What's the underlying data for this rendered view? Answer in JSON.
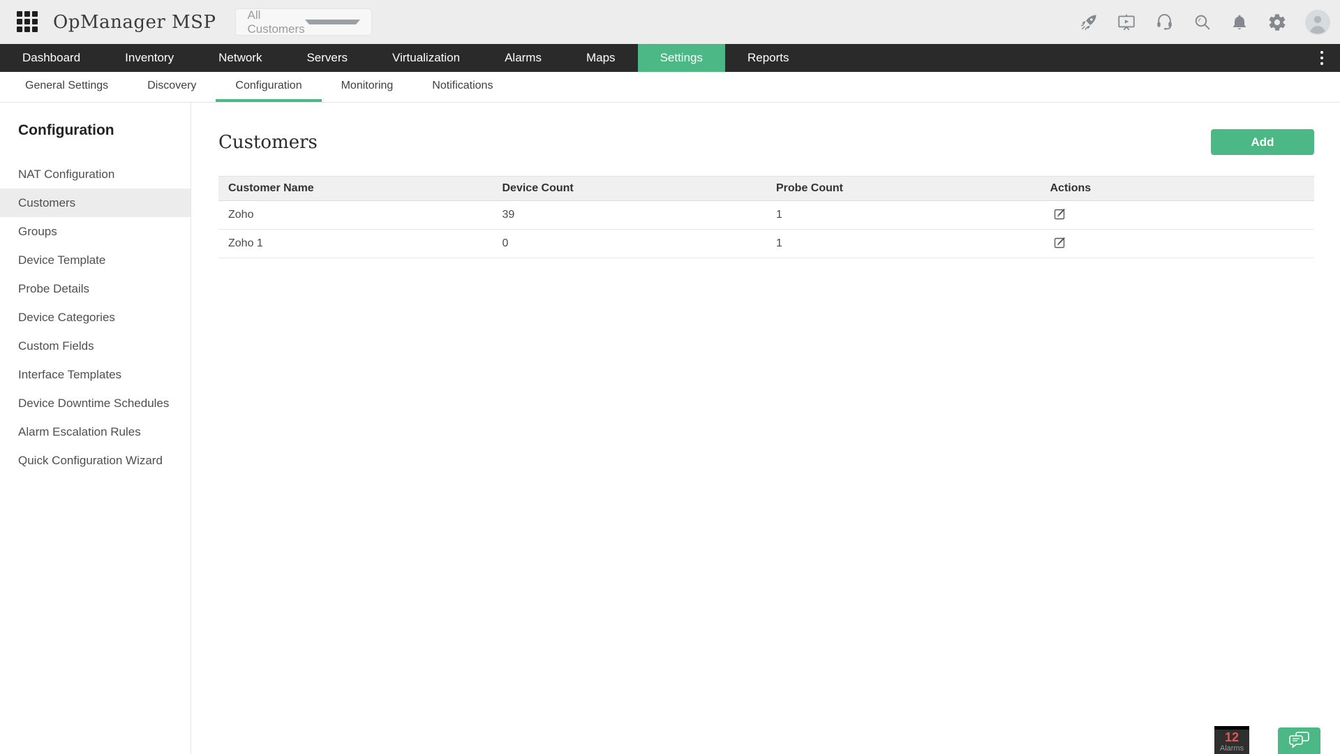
{
  "topbar": {
    "app_title": "OpManager MSP",
    "customer_dropdown": {
      "value": "All Customers"
    }
  },
  "nav": {
    "items": [
      {
        "label": "Dashboard",
        "active": false
      },
      {
        "label": "Inventory",
        "active": false
      },
      {
        "label": "Network",
        "active": false
      },
      {
        "label": "Servers",
        "active": false
      },
      {
        "label": "Virtualization",
        "active": false
      },
      {
        "label": "Alarms",
        "active": false
      },
      {
        "label": "Maps",
        "active": false
      },
      {
        "label": "Settings",
        "active": true
      },
      {
        "label": "Reports",
        "active": false
      }
    ]
  },
  "subnav": {
    "items": [
      {
        "label": "General Settings",
        "active": false
      },
      {
        "label": "Discovery",
        "active": false
      },
      {
        "label": "Configuration",
        "active": true
      },
      {
        "label": "Monitoring",
        "active": false
      },
      {
        "label": "Notifications",
        "active": false
      }
    ]
  },
  "sidebar": {
    "title": "Configuration",
    "items": [
      {
        "label": "NAT Configuration",
        "active": false
      },
      {
        "label": "Customers",
        "active": true
      },
      {
        "label": "Groups",
        "active": false
      },
      {
        "label": "Device Template",
        "active": false
      },
      {
        "label": "Probe Details",
        "active": false
      },
      {
        "label": "Device Categories",
        "active": false
      },
      {
        "label": "Custom Fields",
        "active": false
      },
      {
        "label": "Interface Templates",
        "active": false
      },
      {
        "label": "Device Downtime Schedules",
        "active": false
      },
      {
        "label": "Alarm Escalation Rules",
        "active": false
      },
      {
        "label": "Quick Configuration Wizard",
        "active": false
      }
    ]
  },
  "main": {
    "title": "Customers",
    "add_button_label": "Add",
    "table": {
      "columns": [
        "Customer Name",
        "Device Count",
        "Probe Count",
        "Actions"
      ],
      "rows": [
        {
          "customer_name": "Zoho",
          "device_count": "39",
          "probe_count": "1"
        },
        {
          "customer_name": "Zoho 1",
          "device_count": "0",
          "probe_count": "1"
        }
      ]
    }
  },
  "floating": {
    "alarms_count": "12",
    "alarms_label": "Alarms"
  },
  "colors": {
    "accent_green": "#4cb885",
    "nav_dark": "#2a2a2a",
    "alarm_red": "#e8544f",
    "topbar_gray": "#ededed"
  }
}
